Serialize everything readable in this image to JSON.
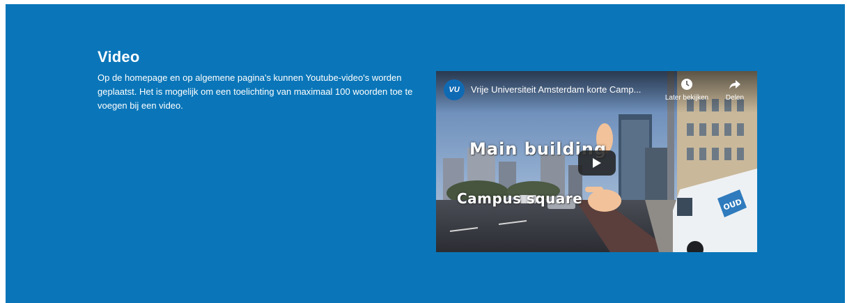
{
  "section": {
    "title": "Video",
    "description": "Op de homepage en op algemene pagina's kunnen Youtube-video's worden geplaatst. Het is mogelijk om een toelichting van maximaal 100 woorden toe te voegen bij een video."
  },
  "video": {
    "channel_logo": "VU",
    "title": "Vrije Universiteit Amsterdam korte Camp...",
    "actions": [
      {
        "label": "Later bekijken",
        "icon": "clock-icon"
      },
      {
        "label": "Delen",
        "icon": "share-icon"
      }
    ],
    "overlay_labels": [
      "Main building",
      "Campus square"
    ],
    "van_logo": "OUD",
    "play_icon": "play-icon"
  },
  "colors": {
    "background": "#0a76b9",
    "channel_logo_bg": "#0f6ab4",
    "text": "#ffffff"
  }
}
